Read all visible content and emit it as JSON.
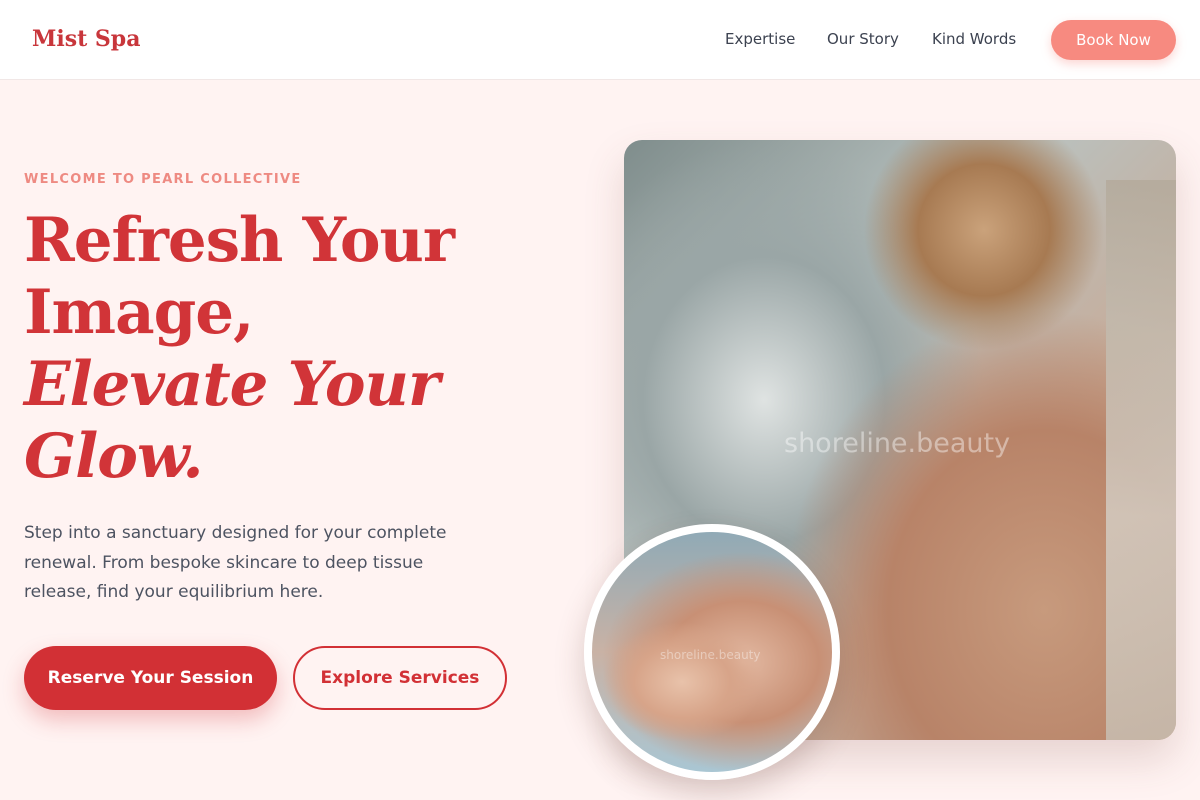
{
  "nav": {
    "logo": "Mist Spa",
    "links": [
      "Expertise",
      "Our Story",
      "Kind Words"
    ],
    "cta": "Book Now"
  },
  "hero": {
    "eyebrow": "WELCOME TO PEARL COLLECTIVE",
    "headline_lines": [
      "Refresh Your",
      "Image,",
      "Elevate Your",
      "Glow."
    ],
    "lead": "Step into a sanctuary designed for your complete renewal. From bespoke skincare to deep tissue release, find your equilibrium here.",
    "primary_button": "Reserve Your Session",
    "secondary_button": "Explore Services"
  },
  "images": {
    "main_watermark": "shoreline.beauty",
    "inset_watermark": "shoreline.beauty"
  },
  "colors": {
    "brand_red": "#d23035",
    "coral": "#f78a80",
    "background": "#fff3f2"
  }
}
